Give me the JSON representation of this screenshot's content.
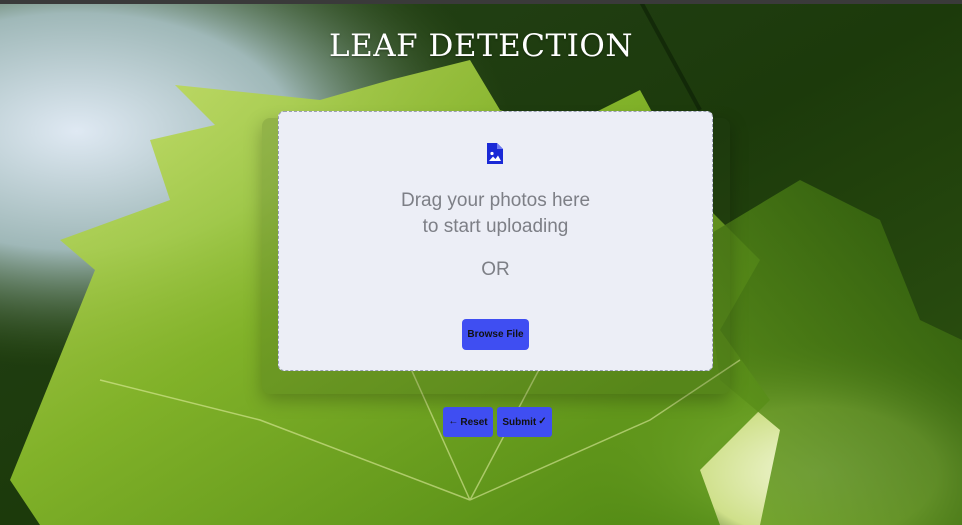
{
  "page": {
    "title": "LEAF DETECTION"
  },
  "upload": {
    "icon": "image-file-icon",
    "drag_line1": "Drag your photos here",
    "drag_line2": "to start uploading",
    "or_text": "OR",
    "browse_label": "Browse File"
  },
  "actions": {
    "reset_icon": "←",
    "reset_label": "Reset",
    "submit_label": "Submit",
    "submit_icon": "✓"
  },
  "colors": {
    "accent": "#3f4ef2",
    "panel": "#eceef6",
    "muted_text": "#7d7f86",
    "icon": "#1a29d6"
  }
}
